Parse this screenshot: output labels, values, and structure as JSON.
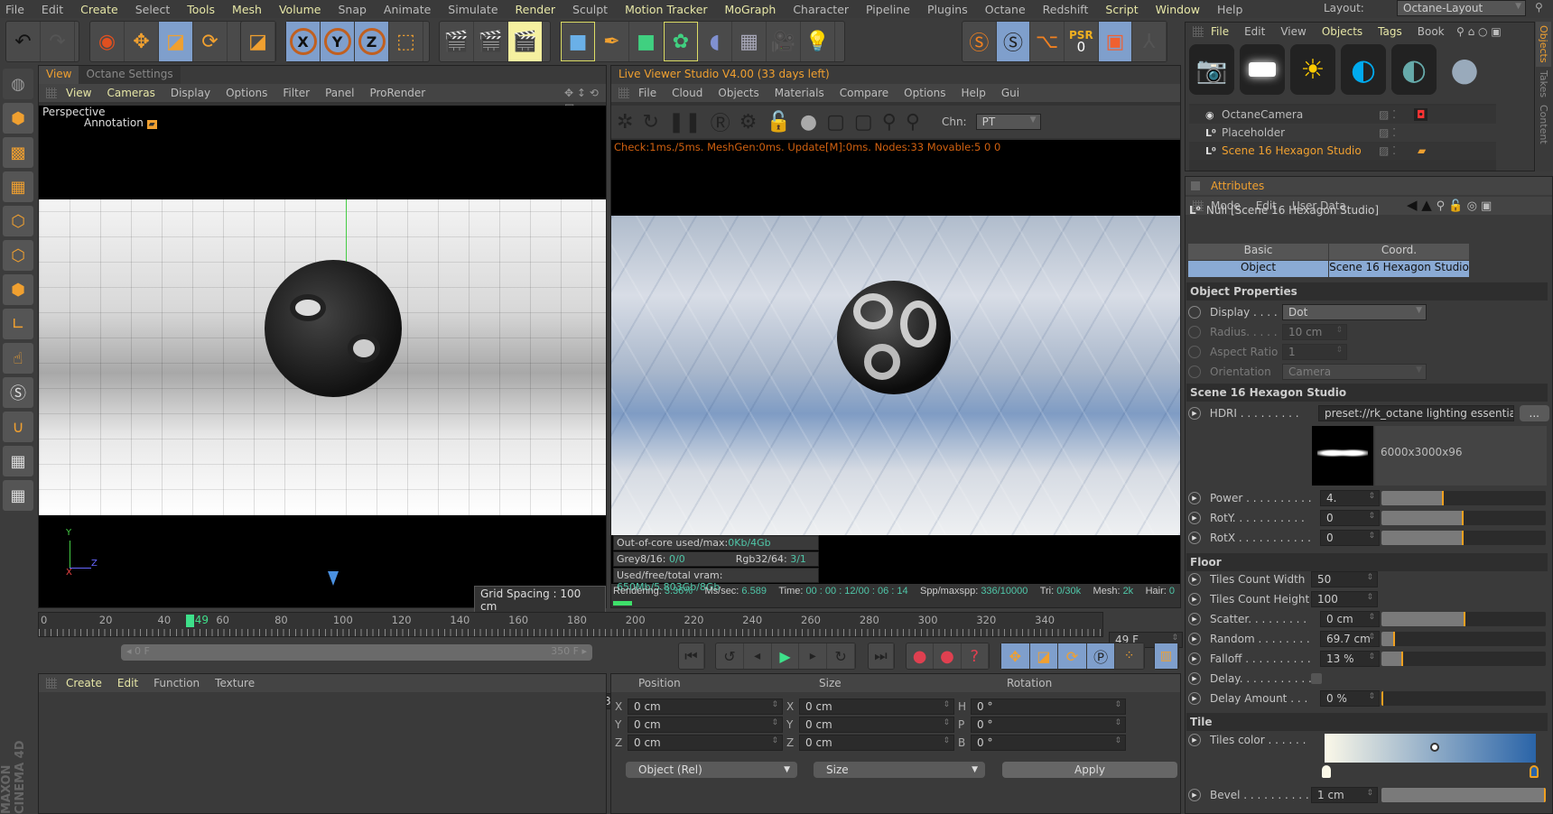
{
  "menu": [
    "File",
    "Edit",
    "Create",
    "Select",
    "Tools",
    "Mesh",
    "Volume",
    "Snap",
    "Animate",
    "Simulate",
    "Render",
    "Sculpt",
    "Motion Tracker",
    "MoGraph",
    "Character",
    "Pipeline",
    "Plugins",
    "Octane",
    "Redshift",
    "Script",
    "Window",
    "Help"
  ],
  "menu_highlighted": [
    "Create",
    "Tools",
    "Mesh",
    "Volume",
    "Render",
    "Motion Tracker",
    "MoGraph",
    "Script",
    "Window"
  ],
  "layout": {
    "label": "Layout:",
    "value": "Octane-Layout"
  },
  "toolbar": {
    "icons": [
      "undo-icon",
      "redo-icon",
      "select-icon",
      "move-icon",
      "scale-icon",
      "rotate-icon",
      "scale-alt-icon",
      "x-axis-icon",
      "y-axis-icon",
      "z-axis-icon",
      "world-coord-icon",
      "render-view-icon",
      "render-picture-icon",
      "render-settings-icon",
      "cube-icon",
      "pen-icon",
      "subdivision-icon",
      "cloner-icon",
      "deformer-icon",
      "floor-icon",
      "camera-icon",
      "light-icon"
    ],
    "axis_labels": [
      "X",
      "Y",
      "Z"
    ],
    "psr_label": "PSR",
    "psr_value": "0"
  },
  "viewport": {
    "tabs": [
      "View",
      "Octane Settings"
    ],
    "menu": [
      "View",
      "Cameras",
      "Display",
      "Options",
      "Filter",
      "Panel",
      "ProRender"
    ],
    "camera_label": "Perspective",
    "annotation": "Annotation",
    "grid_spacing": "Grid Spacing : 100 cm",
    "axes": [
      "Y",
      "Z",
      "X"
    ]
  },
  "live_viewer": {
    "title": "Live Viewer Studio V4.00 (33 days left)",
    "menu": [
      "File",
      "Cloud",
      "Objects",
      "Materials",
      "Compare",
      "Options",
      "Help",
      "Gui"
    ],
    "channel_label": "Chn:",
    "channel_value": "PT",
    "check_line": "Check:1ms./5ms. MeshGen:0ms. Update[M]:0ms. Nodes:33 Movable:5  0 0",
    "stats": {
      "ooc_label": "Out-of-core used/max:",
      "ooc_value": "0Kb/4Gb",
      "grey_label": "Grey8/16: ",
      "grey_value": "0/0",
      "rgb_label": "Rgb32/64: ",
      "rgb_value": "3/1",
      "vram_label": "Used/free/total vram: ",
      "vram_value": "650Mb/5.803Gb/8Gb"
    },
    "status": {
      "rendering_label": "Rendering: ",
      "rendering_value": "3.36%",
      "ms_label": "Ms/sec: ",
      "ms_value": "6.589",
      "time_label": "Time: ",
      "time_value": "00 : 00 : 12/00 : 06 : 14",
      "spp_label": "Spp/maxspp: ",
      "spp_value": "336/10000",
      "tri_label": "Tri: ",
      "tri_value": "0/30k",
      "mesh_label": "Mesh: ",
      "mesh_value": "2k",
      "hair_label": "Hair: ",
      "hair_value": "0"
    },
    "progress": 0.0336
  },
  "timeline": {
    "ticks": [
      "0",
      "20",
      "40",
      "60",
      "80",
      "100",
      "120",
      "140",
      "160",
      "180",
      "200",
      "220",
      "240",
      "260",
      "280",
      "300",
      "320",
      "340"
    ],
    "current": "49",
    "current_field": "49 F",
    "start_field": "0 F",
    "range_start": "0 F",
    "range_end": "350 F",
    "end_field": "350 F"
  },
  "material_manager": {
    "menu": [
      "Create",
      "Edit",
      "Function",
      "Texture"
    ]
  },
  "coords": {
    "headers": [
      "Position",
      "Size",
      "Rotation"
    ],
    "position": [
      {
        "axis": "X",
        "value": "0 cm"
      },
      {
        "axis": "Y",
        "value": "0 cm"
      },
      {
        "axis": "Z",
        "value": "0 cm"
      }
    ],
    "size": [
      {
        "axis": "X",
        "value": "0 cm"
      },
      {
        "axis": "Y",
        "value": "0 cm"
      },
      {
        "axis": "Z",
        "value": "0 cm"
      }
    ],
    "rotation": [
      {
        "axis": "H",
        "value": "0 °"
      },
      {
        "axis": "P",
        "value": "0 °"
      },
      {
        "axis": "B",
        "value": "0 °"
      }
    ],
    "mode": "Object (Rel)",
    "size_mode": "Size",
    "apply": "Apply"
  },
  "object_manager": {
    "menu": [
      "File",
      "Edit",
      "View",
      "Objects",
      "Tags",
      "Book"
    ],
    "objects": [
      {
        "name": "OctaneCamera",
        "selected": false
      },
      {
        "name": "Placeholder",
        "selected": false
      },
      {
        "name": "Scene 16 Hexagon Studio",
        "selected": true
      }
    ],
    "side_tabs": [
      "Objects",
      "Takes",
      "Content"
    ]
  },
  "attributes": {
    "title": "Attributes",
    "menu": [
      "Mode",
      "Edit",
      "User Data"
    ],
    "object_title": "Null [Scene 16 Hexagon Studio]",
    "tabs": [
      [
        "Basic",
        "Coord."
      ],
      [
        "Object",
        "Scene 16 Hexagon Studio"
      ]
    ],
    "object_properties": {
      "title": "Object Properties",
      "rows": [
        {
          "label": "Display . . . .",
          "value": "Dot"
        },
        {
          "label": "Radius. . . . .",
          "value": "10 cm"
        },
        {
          "label": "Aspect Ratio",
          "value": "1"
        },
        {
          "label": "Orientation",
          "value": "Camera"
        }
      ]
    },
    "studio": {
      "title": "Scene 16 Hexagon Studio",
      "hdri_label": "HDRI . . . . . . . . .",
      "hdri_value": "preset://rk_octane lighting essentials",
      "hdri_button": "...",
      "hdri_info": "6000x3000x96",
      "rows": [
        {
          "label": "Power . . . . . . . . . .",
          "value": "4.",
          "slider": 0.38
        },
        {
          "label": "RotY. . . . . . . . . . .",
          "value": "0",
          "slider": 0.5
        },
        {
          "label": "RotX . . . . . . . . . . .",
          "value": "0",
          "slider": 0.5
        }
      ]
    },
    "floor": {
      "title": "Floor",
      "rows": [
        {
          "label": "Tiles Count Width",
          "value": "50"
        },
        {
          "label": "Tiles Count Height",
          "value": "100"
        },
        {
          "label": "Scatter. . . . . . . . . .",
          "value": "0 cm",
          "slider": 0.51
        },
        {
          "label": "Random . . . . . . . .",
          "value": "69.7 cm",
          "slider": 0.08
        },
        {
          "label": "Falloff . . . . . . . . . .",
          "value": "13 %",
          "slider": 0.13
        },
        {
          "label": "Delay. . . . . . . . . . .",
          "checked": false
        },
        {
          "label": "Delay Amount . . .",
          "value": "0 %",
          "slider": 0.0
        }
      ]
    },
    "tile": {
      "title": "Tile",
      "color_label": "Tiles color . . . . . .",
      "gradient": [
        "#fbf8e8",
        "#2a64a8"
      ],
      "bevel_label": "Bevel . . . . . . . . . . .",
      "bevel_value": "1 cm",
      "bevel_slider": 1.0
    }
  },
  "colors": {
    "accent": "#f0a030",
    "menu_highlight": "#e6e6a6",
    "stat_value": "#4fc6a8",
    "selected_tab": "#8aaad4",
    "progress": "#3ee06a"
  },
  "watermark": "MAXON CINEMA 4D"
}
